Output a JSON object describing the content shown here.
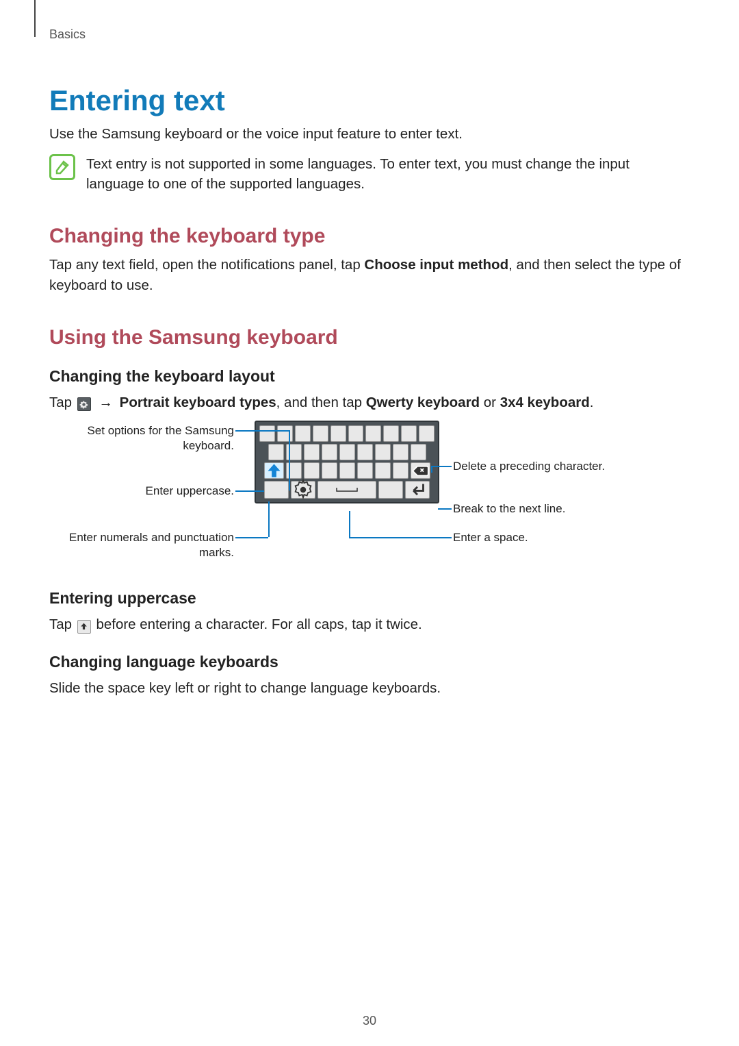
{
  "header": {
    "breadcrumb": "Basics"
  },
  "title": "Entering text",
  "intro": "Use the Samsung keyboard or the voice input feature to enter text.",
  "note": "Text entry is not supported in some languages. To enter text, you must change the input language to one of the supported languages.",
  "section1": {
    "heading": "Changing the keyboard type",
    "body_pre": "Tap any text field, open the notifications panel, tap ",
    "body_bold": "Choose input method",
    "body_post": ", and then select the type of keyboard to use."
  },
  "section2": {
    "heading": "Using the Samsung keyboard",
    "sub1": {
      "heading": "Changing the keyboard layout",
      "pre": "Tap ",
      "arrow": "→",
      "bold1": "Portrait keyboard types",
      "mid": ", and then tap ",
      "bold2": "Qwerty keyboard",
      "or": " or ",
      "bold3": "3x4 keyboard",
      "post": "."
    },
    "callouts": {
      "settings": "Set options for the Samsung keyboard.",
      "upper": "Enter uppercase.",
      "numpunct": "Enter numerals and punctuation marks.",
      "delete": "Delete a preceding character.",
      "newline": "Break to the next line.",
      "space": "Enter a space."
    },
    "sub2": {
      "heading": "Entering uppercase",
      "pre": "Tap ",
      "post": " before entering a character. For all caps, tap it twice."
    },
    "sub3": {
      "heading": "Changing language keyboards",
      "body": "Slide the space key left or right to change language keyboards."
    }
  },
  "page_number": "30"
}
